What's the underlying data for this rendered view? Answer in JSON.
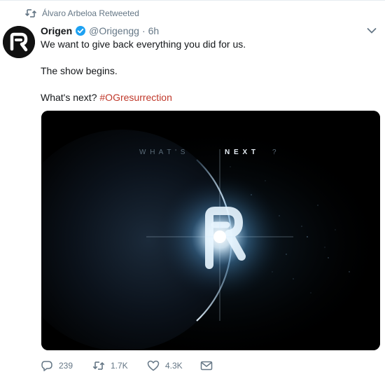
{
  "retweet_context": {
    "label": "Álvaro Arbeloa Retweeted",
    "icon": "retweet-icon"
  },
  "author": {
    "name": "Origen",
    "handle": "@Origengg",
    "separator": "·",
    "time": "6h",
    "verified": true,
    "avatar_letter": "R",
    "avatar_bg": "#111111"
  },
  "tweet": {
    "line1": "We want to give back everything you did for us.",
    "line2": "The show begins.",
    "line3_prefix": "What's next?",
    "hashtag": "#OGresurrection",
    "hashtag_color": "#c0392b"
  },
  "media": {
    "caption_dim": "W H A T ' S",
    "caption_bright": "N E X T",
    "caption_end": "?",
    "glow_color": "#bfe4ff"
  },
  "actions": {
    "reply_count": "239",
    "retweet_count": "1.7K",
    "like_count": "4.3K"
  },
  "colors": {
    "text": "#14171a",
    "muted": "#657786",
    "verified": "#1da1f2"
  }
}
